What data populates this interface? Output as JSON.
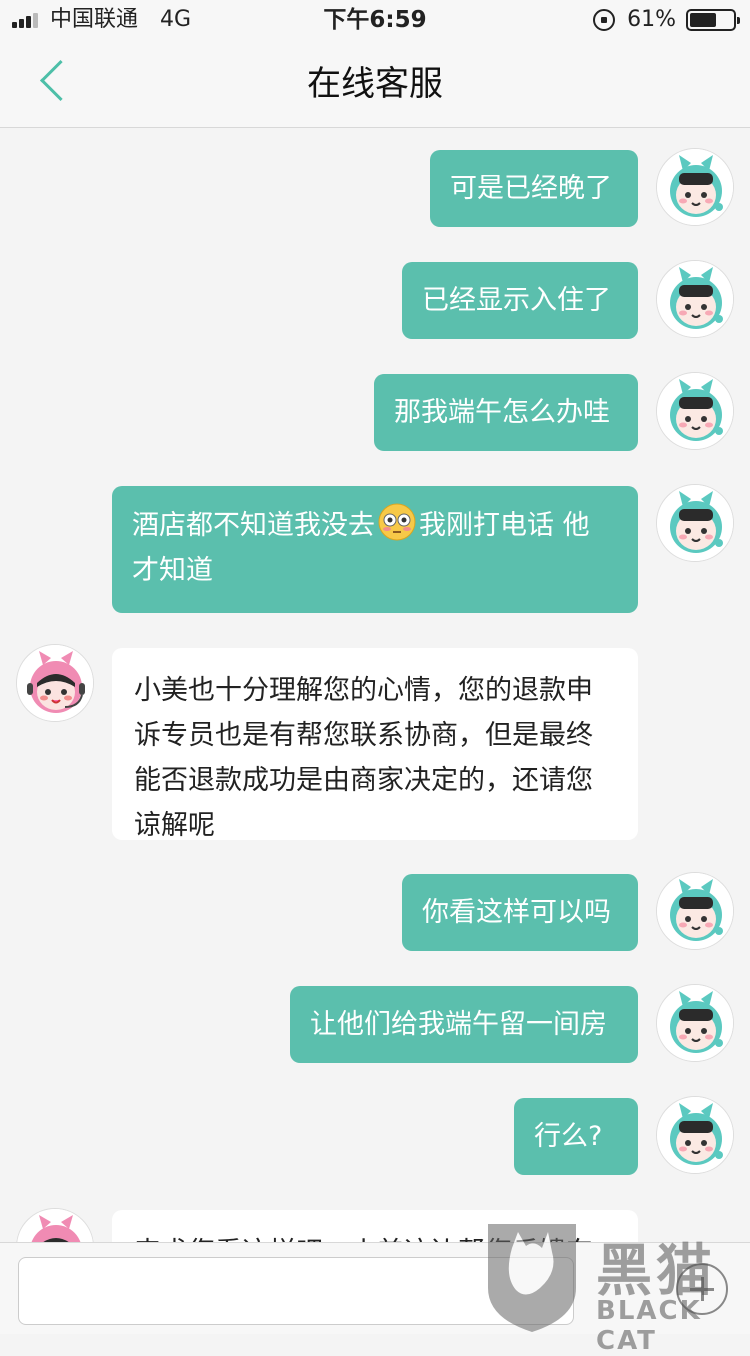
{
  "status_bar": {
    "carrier": "中国联通",
    "network": "4G",
    "time": "下午6:59",
    "battery_percent": "61%",
    "battery_level": 0.61
  },
  "nav": {
    "title": "在线客服",
    "back_icon": "chevron-left-icon"
  },
  "messages": [
    {
      "side": "out",
      "text": "可是已经晚了"
    },
    {
      "side": "out",
      "text": "已经显示入住了"
    },
    {
      "side": "out",
      "text": "那我端午怎么办哇"
    },
    {
      "side": "out",
      "text_before_emoji": "酒店都不知道我没去",
      "emoji": "flushed-face-emoji",
      "text_after_emoji": "我刚打电话 他",
      "text_line2": "才知道"
    },
    {
      "side": "in",
      "lines": [
        "小美也十分理解您的心情，您的退款申",
        "诉专员也是有帮您联系协商，但是最终",
        "能否退款成功是由商家决定的，还请您",
        "谅解呢"
      ]
    },
    {
      "side": "out",
      "text": "你看这样可以吗"
    },
    {
      "side": "out",
      "text": "让他们给我端午留一间房"
    },
    {
      "side": "out",
      "text": "行么?"
    },
    {
      "side": "in",
      "text": "来求您看这样吧，小美这边帮您反馈东"
    }
  ],
  "input": {
    "placeholder": "",
    "add_icon": "plus-circle-icon"
  },
  "watermark": {
    "text": "黑猫",
    "subtext": "BLACK CAT"
  },
  "colors": {
    "accent": "#5bbfad",
    "background": "#f4f4f4"
  }
}
